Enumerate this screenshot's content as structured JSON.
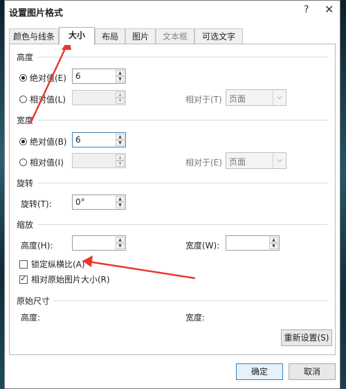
{
  "dialog": {
    "title": "设置图片格式",
    "help": "?",
    "close": "✕"
  },
  "tabs": [
    {
      "label": "颜色与线条"
    },
    {
      "label": "大小"
    },
    {
      "label": "布局"
    },
    {
      "label": "图片"
    },
    {
      "label": "文本框"
    },
    {
      "label": "可选文字"
    }
  ],
  "height": {
    "section": "高度",
    "absolute_label": "绝对值(E)",
    "absolute_value": "6",
    "relative_label": "相对值(L)",
    "relative_to_label": "相对于(T)",
    "relative_to_value": "页面"
  },
  "width": {
    "section": "宽度",
    "absolute_label": "绝对值(B)",
    "absolute_value": "6",
    "relative_label": "相对值(I)",
    "relative_to_label": "相对于(E)",
    "relative_to_value": "页面"
  },
  "rotation": {
    "section": "旋转",
    "label": "旋转(T):",
    "value": "0°"
  },
  "scale": {
    "section": "缩放",
    "height_label": "高度(H):",
    "height_value": "",
    "width_label": "宽度(W):",
    "width_value": "",
    "lock_aspect_label": "锁定纵横比(A)",
    "lock_aspect_checked": false,
    "relative_original_label": "相对原始图片大小(R)",
    "relative_original_checked": true
  },
  "original_size": {
    "section": "原始尺寸",
    "height_label": "高度:",
    "width_label": "宽度:"
  },
  "buttons": {
    "reset": "重新设置(S)",
    "ok": "确定",
    "cancel": "取消"
  },
  "colors": {
    "arrow": "#e8382c",
    "focus_border": "#3c7fb1"
  }
}
